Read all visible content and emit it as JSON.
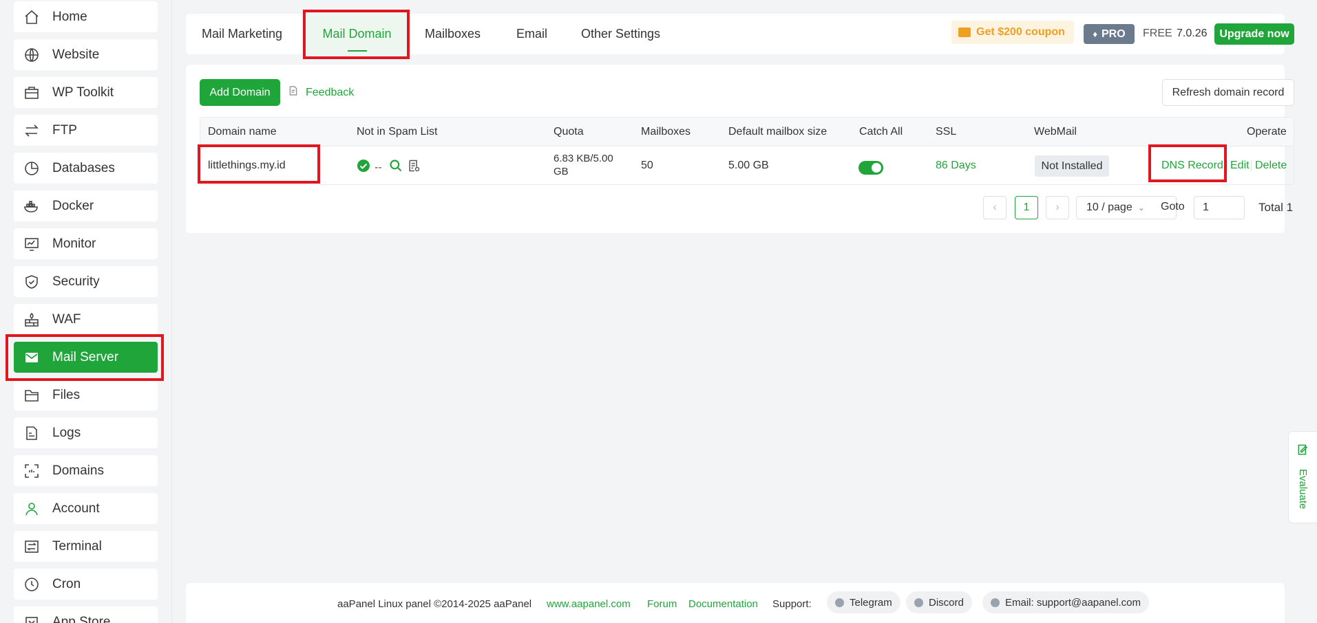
{
  "sidebar": {
    "items": [
      {
        "label": "Home",
        "icon": "home-icon"
      },
      {
        "label": "Website",
        "icon": "globe-icon"
      },
      {
        "label": "WP Toolkit",
        "icon": "toolbox-icon"
      },
      {
        "label": "FTP",
        "icon": "transfer-icon"
      },
      {
        "label": "Databases",
        "icon": "pie-chart-icon"
      },
      {
        "label": "Docker",
        "icon": "docker-icon"
      },
      {
        "label": "Monitor",
        "icon": "monitor-icon"
      },
      {
        "label": "Security",
        "icon": "shield-icon"
      },
      {
        "label": "WAF",
        "icon": "firewall-icon"
      },
      {
        "label": "Mail Server",
        "icon": "mail-icon",
        "active": true
      },
      {
        "label": "Files",
        "icon": "folder-icon"
      },
      {
        "label": "Logs",
        "icon": "log-icon"
      },
      {
        "label": "Domains",
        "icon": "domain-icon"
      },
      {
        "label": "Account",
        "icon": "user-icon"
      },
      {
        "label": "Terminal",
        "icon": "terminal-icon"
      },
      {
        "label": "Cron",
        "icon": "clock-icon"
      },
      {
        "label": "App Store",
        "icon": "store-icon"
      }
    ]
  },
  "tabs": {
    "mail_marketing": "Mail Marketing",
    "mail_domain": "Mail Domain",
    "mailboxes": "Mailboxes",
    "email": "Email",
    "other_settings": "Other Settings"
  },
  "header": {
    "coupon": "Get $200 coupon",
    "pro": "PRO",
    "free": "FREE",
    "version": "7.0.26",
    "upgrade": "Upgrade now"
  },
  "toolbar": {
    "add_domain": "Add Domain",
    "feedback": "Feedback",
    "refresh": "Refresh domain record"
  },
  "table": {
    "columns": {
      "domain": "Domain name",
      "spam": "Not in Spam List",
      "quota": "Quota",
      "mailboxes": "Mailboxes",
      "default_size": "Default mailbox size",
      "catch_all": "Catch All",
      "ssl": "SSL",
      "webmail": "WebMail",
      "operate": "Operate"
    },
    "rows": [
      {
        "domain": "littlethings.my.id",
        "spam_status": "--",
        "quota_line1": "6.83 KB/5.00",
        "quota_line2": "GB",
        "mailboxes": "50",
        "default_size": "5.00 GB",
        "catch_all": true,
        "ssl": "86 Days",
        "webmail": "Not Installed",
        "op_dns": "DNS Record",
        "op_edit": "Edit",
        "op_delete": "Delete"
      }
    ]
  },
  "pagination": {
    "current": "1",
    "page_size": "10 / page",
    "goto_label": "Goto",
    "goto_value": "1",
    "total": "Total 1"
  },
  "evaluate": "Evaluate",
  "footer": {
    "copyright": "aaPanel Linux panel ©2014-2025 aaPanel",
    "site": "www.aapanel.com",
    "forum": "Forum",
    "docs": "Documentation",
    "support": "Support:",
    "telegram": "Telegram",
    "discord": "Discord",
    "email": "Email: support@aapanel.com"
  },
  "colors": {
    "accent": "#20a53a",
    "highlight_box": "#e0171f",
    "coupon": "#f0a020"
  }
}
